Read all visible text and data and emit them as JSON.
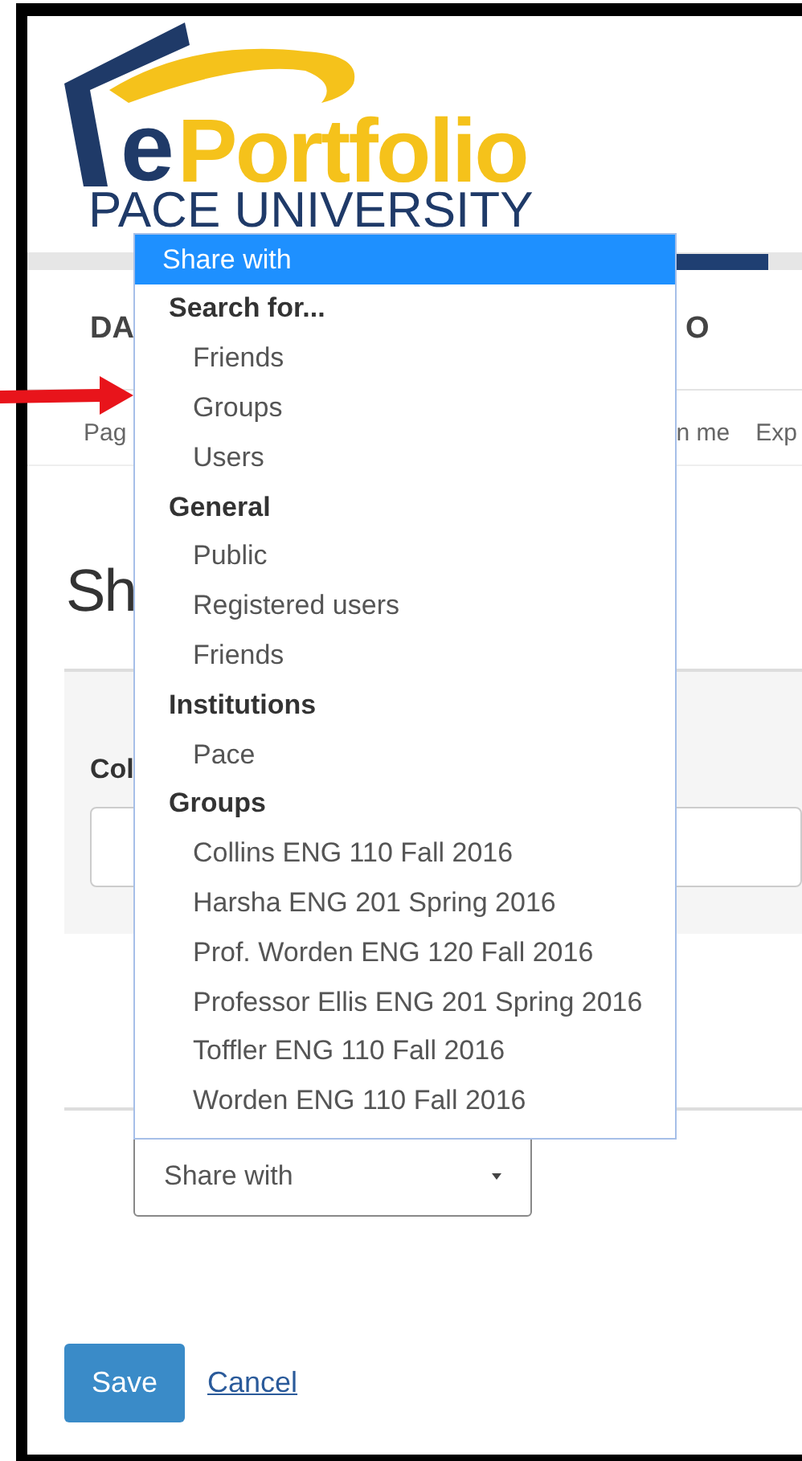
{
  "logo": {
    "letter": "e",
    "word": "Portfolio",
    "subtitle": "PACE UNIVERSITY"
  },
  "nav_tabs": [
    "DA",
    "O"
  ],
  "sub_nav": [
    "Pag",
    "n me",
    "Exp"
  ],
  "heading": "Sh",
  "panel": {
    "label": "Col"
  },
  "share_select": {
    "value": "Share with"
  },
  "dropdown": {
    "items": [
      {
        "kind": "option",
        "label": "Share with",
        "selected": true
      },
      {
        "kind": "group",
        "label": "Search for...",
        "options": [
          {
            "label": "Friends",
            "selected": false
          },
          {
            "label": "Groups",
            "selected": false
          },
          {
            "label": "Users",
            "selected": false
          }
        ]
      },
      {
        "kind": "group",
        "label": "General",
        "options": [
          {
            "label": "Public",
            "selected": false
          },
          {
            "label": "Registered users",
            "selected": false
          },
          {
            "label": "Friends",
            "selected": false
          }
        ]
      },
      {
        "kind": "group",
        "label": "Institutions",
        "options": [
          {
            "label": "Pace",
            "selected": false
          }
        ]
      },
      {
        "kind": "group",
        "label": "Groups",
        "options": [
          {
            "label": "Collins ENG 110 Fall 2016",
            "selected": false
          },
          {
            "label": "Harsha ENG 201 Spring 2016",
            "selected": false
          },
          {
            "label": "Prof. Worden ENG 120 Fall 2016",
            "selected": false
          },
          {
            "label": "Professor Ellis ENG 201 Spring 2016",
            "selected": false
          },
          {
            "label": "Toffler ENG 110 Fall 2016",
            "selected": false
          },
          {
            "label": "Worden ENG 110 Fall 2016",
            "selected": false
          }
        ]
      }
    ]
  },
  "buttons": {
    "save": "Save",
    "cancel": "Cancel"
  }
}
